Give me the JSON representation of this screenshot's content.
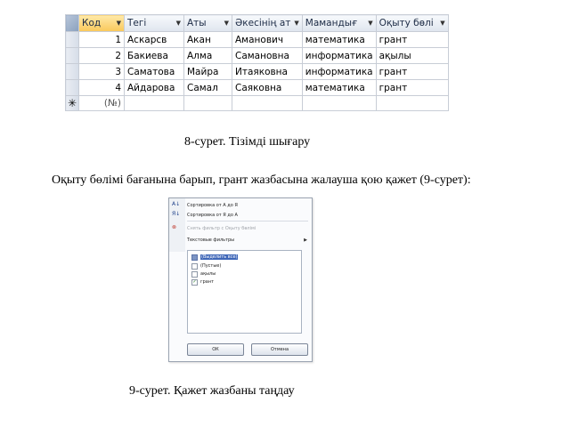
{
  "table": {
    "columns": [
      "Код",
      "Тегі",
      "Аты",
      "Әкесінің ат",
      "Мамандығ",
      "Оқыту бөлі"
    ],
    "rows": [
      [
        "1",
        "Аскарсв",
        "Акан",
        "Аманович",
        "математика",
        "грант"
      ],
      [
        "2",
        "Бакиева",
        "Алма",
        "Самановна",
        "информатика",
        "ақылы"
      ],
      [
        "3",
        "Саматова",
        "Майра",
        "Итаяковна",
        "информатика",
        "грант"
      ],
      [
        "4",
        "Айдарова",
        "Самал",
        "Саяковна",
        "математика",
        "грант"
      ]
    ],
    "new_row_marker": "(№)",
    "new_row_icon": "asterisk-icon"
  },
  "caption_8": "8-сурет. Тізімді шығару",
  "paragraph": "Оқыту бөлімі бағанына барып, грант жазбасына жалауша қою қажет (9-сурет):",
  "filter_menu": {
    "sort_asc": "Сортировка от А до Я",
    "sort_desc": "Сортировка от Я до А",
    "clear_filter": "Снять фильтр с Оқыту бөлімі",
    "text_filters": "Текстовые фильтры",
    "options": [
      {
        "label": "(Выделить все)",
        "checked": false,
        "highlighted": true
      },
      {
        "label": "(Пустые)",
        "checked": false,
        "highlighted": false
      },
      {
        "label": "ақылы",
        "checked": false,
        "highlighted": false
      },
      {
        "label": "грант",
        "checked": true,
        "highlighted": false
      }
    ],
    "ok_label": "ОК",
    "cancel_label": "Отмена"
  },
  "caption_9": "9-сурет. Қажет жазбаны таңдау"
}
